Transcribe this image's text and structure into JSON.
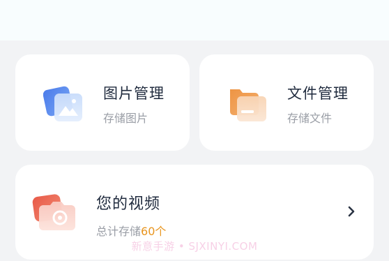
{
  "cards": {
    "images": {
      "title": "图片管理",
      "subtitle": "存储图片",
      "icon": "image-gallery-icon"
    },
    "files": {
      "title": "文件管理",
      "subtitle": "存储文件",
      "icon": "folder-icon"
    },
    "videos": {
      "title": "您的视频",
      "subtitle_prefix": "总计存储",
      "count": "60个",
      "icon": "camera-icon",
      "arrow_icon": "chevron-right-icon"
    }
  },
  "watermark": "新意手游 • SJXINYI.COM",
  "colors": {
    "accent_count": "#e8951f",
    "image_icon": "#5b8def",
    "folder_icon": "#f0a052",
    "camera_icon": "#ee6f5c"
  }
}
